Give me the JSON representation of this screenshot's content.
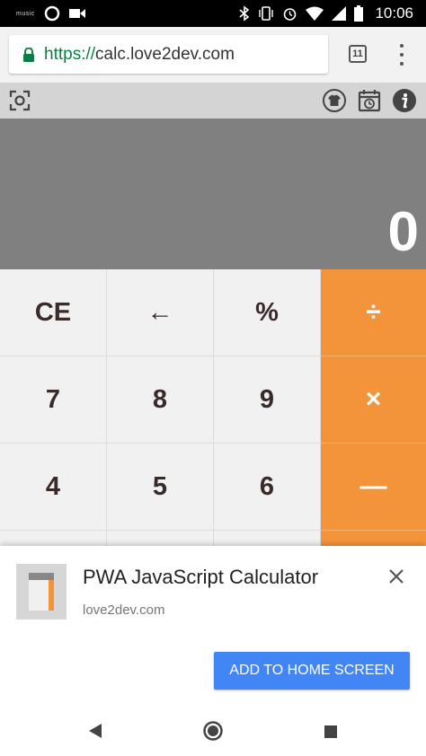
{
  "status_bar": {
    "music_label": "music",
    "time": "10:06"
  },
  "browser": {
    "url_scheme": "https://",
    "url_host": "calc.love2dev.com",
    "tab_count": "11",
    "colors": {
      "secure": "#0b8043"
    }
  },
  "toolbar": {
    "icons": [
      "scan-icon",
      "theme-shirt-icon",
      "history-icon",
      "info-icon"
    ]
  },
  "display": {
    "value": "0"
  },
  "keypad": {
    "rows": [
      [
        "CE",
        "←",
        "%",
        "÷"
      ],
      [
        "7",
        "8",
        "9",
        "×"
      ],
      [
        "4",
        "5",
        "6",
        "—"
      ]
    ],
    "colors": {
      "operator": "#f4943a",
      "key": "#f1f1f1"
    }
  },
  "install_banner": {
    "title": "PWA JavaScript Calculator",
    "domain": "love2dev.com",
    "add_button_label": "ADD TO HOME SCREEN",
    "colors": {
      "button": "#4285f4"
    }
  },
  "nav_bar": {
    "icons": [
      "back-triangle-icon",
      "home-circle-icon",
      "recents-square-icon"
    ]
  }
}
